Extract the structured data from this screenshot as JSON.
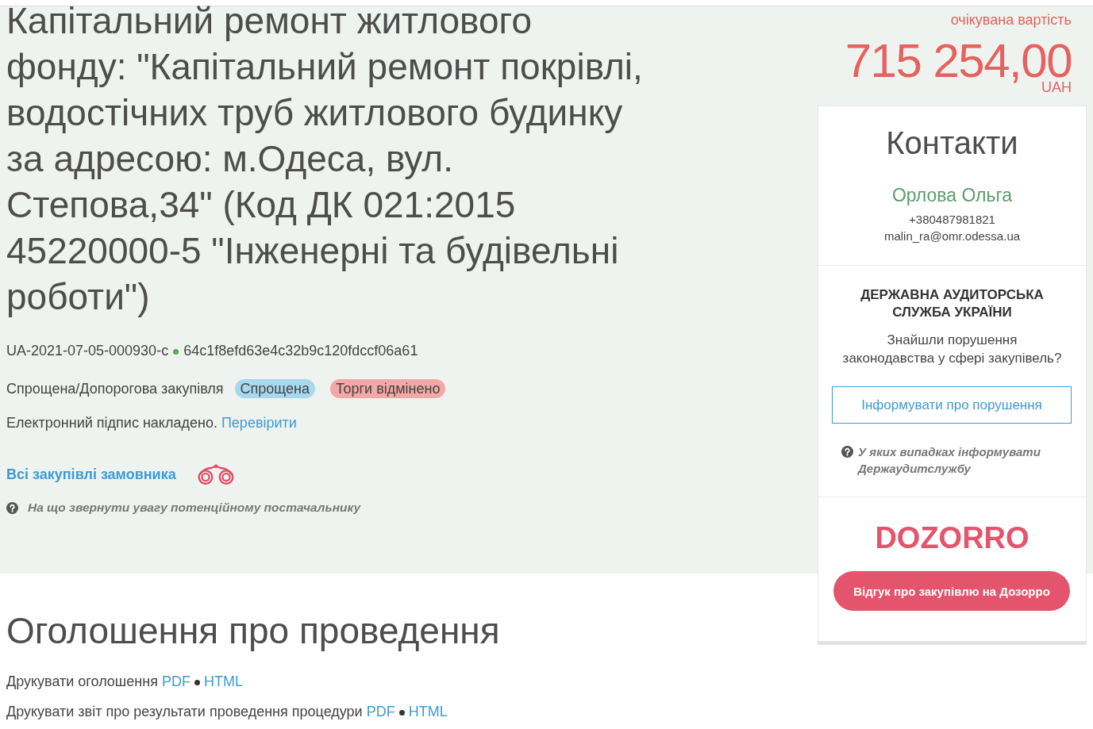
{
  "tender": {
    "title": "Капітальний ремонт житлового фонду: \"Капітальний ремонт покрівлі, водостічних труб житлового будинку за адресою: м.Одеса, вул. Степова,34\" (Код ДК 021:2015 45220000-5 \"Інженерні та будівельні роботи\")",
    "id": "UA-2021-07-05-000930-c",
    "hash": "64c1f8efd63e4c32b9c120fdccf06a61",
    "procedure_type": "Спрощена/Допорогова закупівля",
    "tags": [
      {
        "label": "Спрощена",
        "color": "#a8d8ee"
      },
      {
        "label": "Торги відмінено",
        "color": "#f2a8a6"
      }
    ],
    "signature": {
      "text": "Електронний підпис накладено.",
      "link": "Перевірити"
    },
    "customer_link": "Всі закупівлі замовника",
    "help_hint": "На що звернути увагу потенційному постачальнику"
  },
  "value": {
    "label": "очікувана вартість",
    "amount": "715 254,00",
    "currency": "UAH"
  },
  "contacts": {
    "title": "Контакти",
    "name": "Орлова Ольга",
    "phone": "+380487981821",
    "email": "malin_ra@omr.odessa.ua"
  },
  "audit": {
    "title": "ДЕРЖАВНА АУДИТОРСЬКА СЛУЖБА УКРАЇНИ",
    "question": "Знайшли порушення законодавства у сфері закупівель?",
    "button": "Інформувати про порушення",
    "hint": "У яких випадках інформувати Держаудитслужбу"
  },
  "dozorro": {
    "logo": "DOZORRO",
    "button": "Відгук про закупівлю на Дозорро"
  },
  "announcement": {
    "title": "Оголошення про проведення",
    "print_lines": [
      {
        "label": "Друкувати оголошення",
        "links": [
          "PDF",
          "HTML"
        ]
      },
      {
        "label": "Друкувати звіт про результати проведення процедури",
        "links": [
          "PDF",
          "HTML"
        ]
      }
    ]
  }
}
